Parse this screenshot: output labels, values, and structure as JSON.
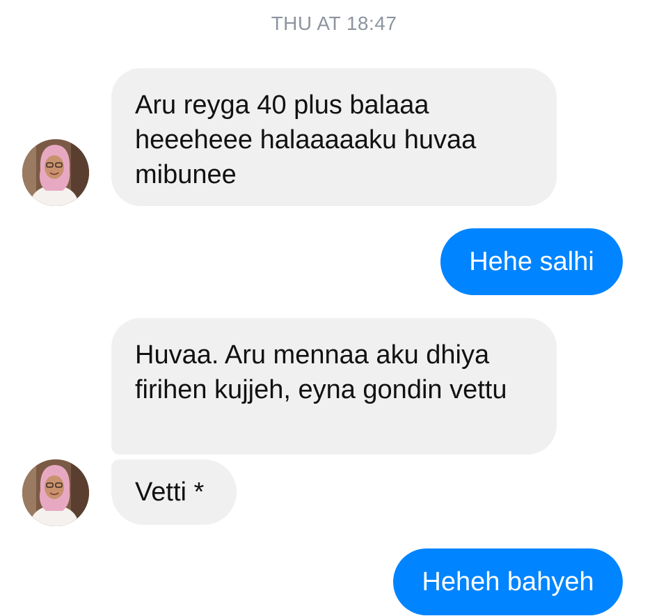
{
  "conversation": {
    "timestamp": "THU AT 18:47",
    "messages": [
      {
        "direction": "incoming",
        "text": "Aru reyga 40 plus balaaa heeeheee halaaaaaku huvaa mibunee"
      },
      {
        "direction": "outgoing",
        "text": "Hehe salhi"
      },
      {
        "direction": "incoming",
        "text": "Huvaa. Aru mennaa aku dhiya firihen kujjeh, eyna gondin vettu"
      },
      {
        "direction": "incoming",
        "text": "Vetti *"
      },
      {
        "direction": "outgoing",
        "text": "Heheh bahyeh"
      }
    ]
  },
  "colors": {
    "incoming_bubble": "#f0f0f0",
    "outgoing_bubble": "#0084ff",
    "timestamp_text": "#8d949e"
  },
  "icons": {
    "contact_avatar": "avatar-woman-pink-hijab-icon"
  }
}
